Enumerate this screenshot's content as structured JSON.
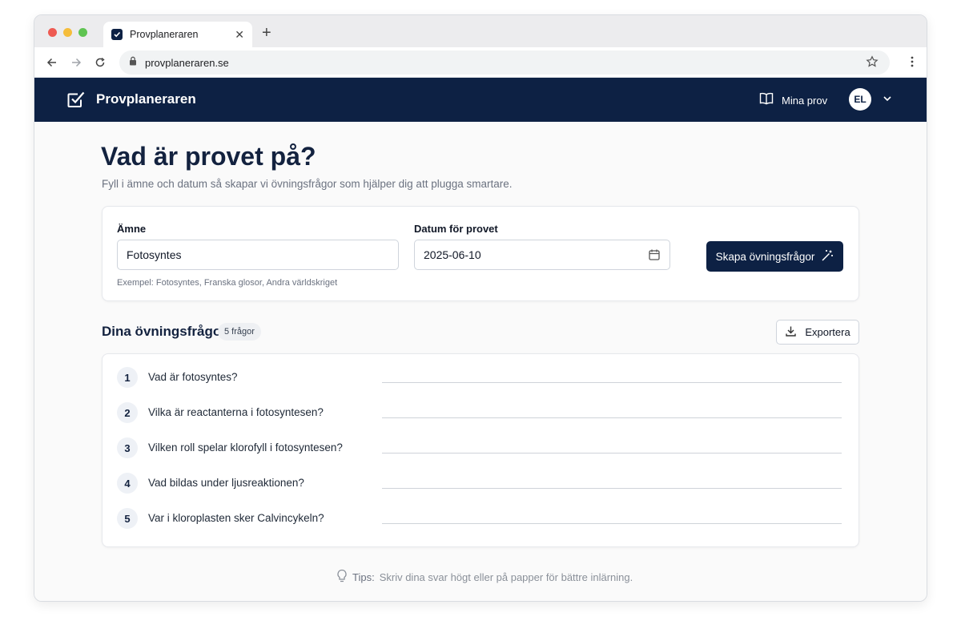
{
  "browser": {
    "tab_title": "Provplaneraren",
    "url": "provplaneraren.se"
  },
  "header": {
    "brand": "Provplaneraren",
    "my_tests_label": "Mina prov",
    "avatar_initials": "EL",
    "bg_color": "#0d2144"
  },
  "page": {
    "title": "Vad är provet på?",
    "subtitle": "Fyll i ämne och datum så skapar vi övningsfrågor som hjälper dig att plugga smartare."
  },
  "form": {
    "subject_label": "Ämne",
    "subject_value": "Fotosyntes",
    "subject_hint": "Exempel: Fotosyntes, Franska glosor, Andra världskriget",
    "date_label": "Datum för provet",
    "date_value": "2025-06-10",
    "submit_label": "Skapa övningsfrågor"
  },
  "questions": {
    "title": "Dina övningsfrågor",
    "count_label": "5 frågor",
    "export_label": "Exportera",
    "items": [
      {
        "num": "1",
        "text": "Vad är fotosyntes?"
      },
      {
        "num": "2",
        "text": "Vilka är reactanterna i fotosyntesen?"
      },
      {
        "num": "3",
        "text": "Vilken roll spelar klorofyll i fotosyntesen?"
      },
      {
        "num": "4",
        "text": "Vad bildas under ljusreaktionen?"
      },
      {
        "num": "5",
        "text": "Var i kloroplasten sker Calvincykeln?"
      }
    ]
  },
  "tips": {
    "prefix": "Tips:",
    "text": "Skriv dina svar högt eller på papper för bättre inlärning."
  }
}
